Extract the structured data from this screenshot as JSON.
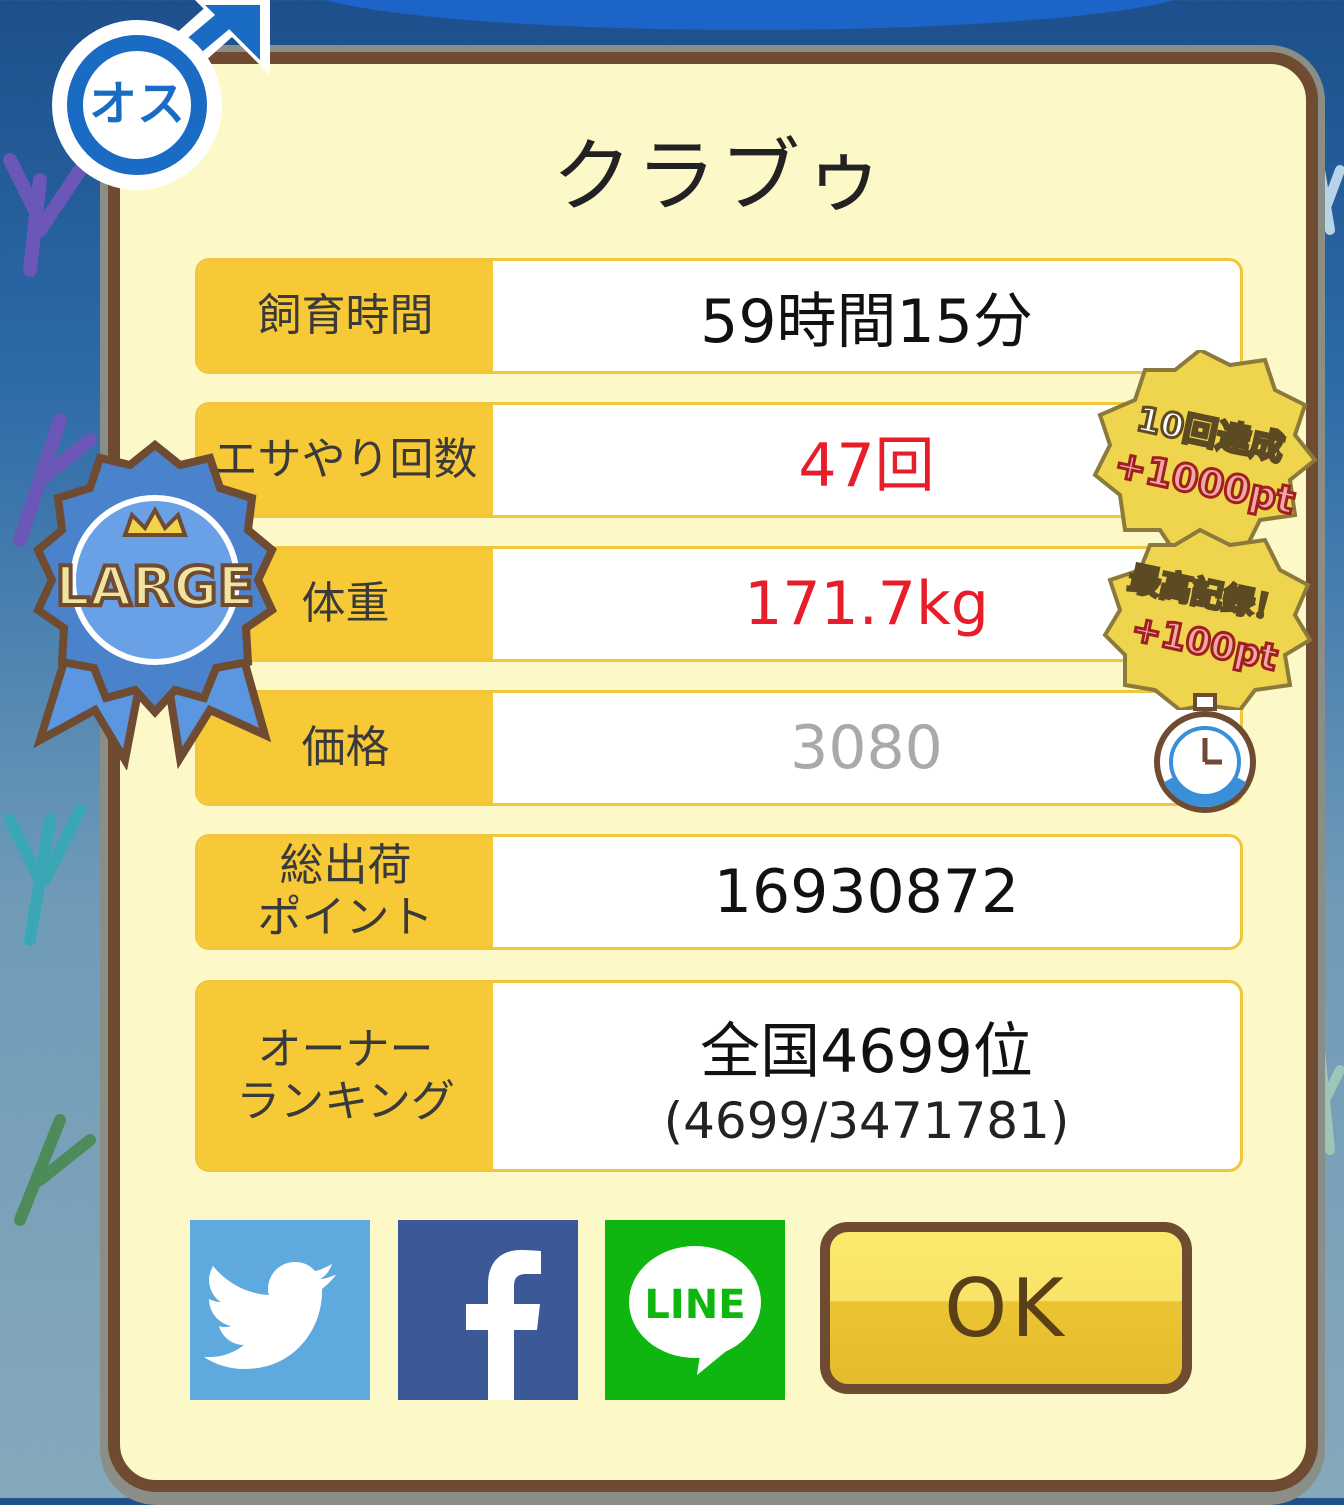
{
  "gender_badge": {
    "text": "オス",
    "color": "#1a6bc4"
  },
  "title": "クラブゥ",
  "rows": [
    {
      "label": "飼育時間",
      "value": "59時間15分"
    },
    {
      "label": "エサやり回数",
      "value": "47回",
      "value_color": "#e81d2a"
    },
    {
      "label": "体重",
      "value": "171.7kg",
      "value_color": "#e81d2a"
    },
    {
      "label": "価格",
      "value": "3080",
      "value_color": "#a9a9a9"
    },
    {
      "label": "総出荷\nポイント",
      "value": "16930872"
    },
    {
      "label": "オーナー\nランキング",
      "value": "全国4699位",
      "sub": "(4699/3471781)"
    }
  ],
  "size_ribbon": {
    "text": "LARGE",
    "icon": "crown-icon"
  },
  "stickers": [
    {
      "line1": "10回達成",
      "line2": "+1000pt"
    },
    {
      "line1": "最高記録！",
      "line2": "+100pt"
    }
  ],
  "share": {
    "twitter": {
      "icon": "twitter-bird-icon",
      "color": "#5ea9dd"
    },
    "facebook": {
      "icon": "facebook-f-icon",
      "color": "#3b5997"
    },
    "line": {
      "text": "LINE",
      "color": "#10b610"
    }
  },
  "ok_button": {
    "label": "OK"
  }
}
